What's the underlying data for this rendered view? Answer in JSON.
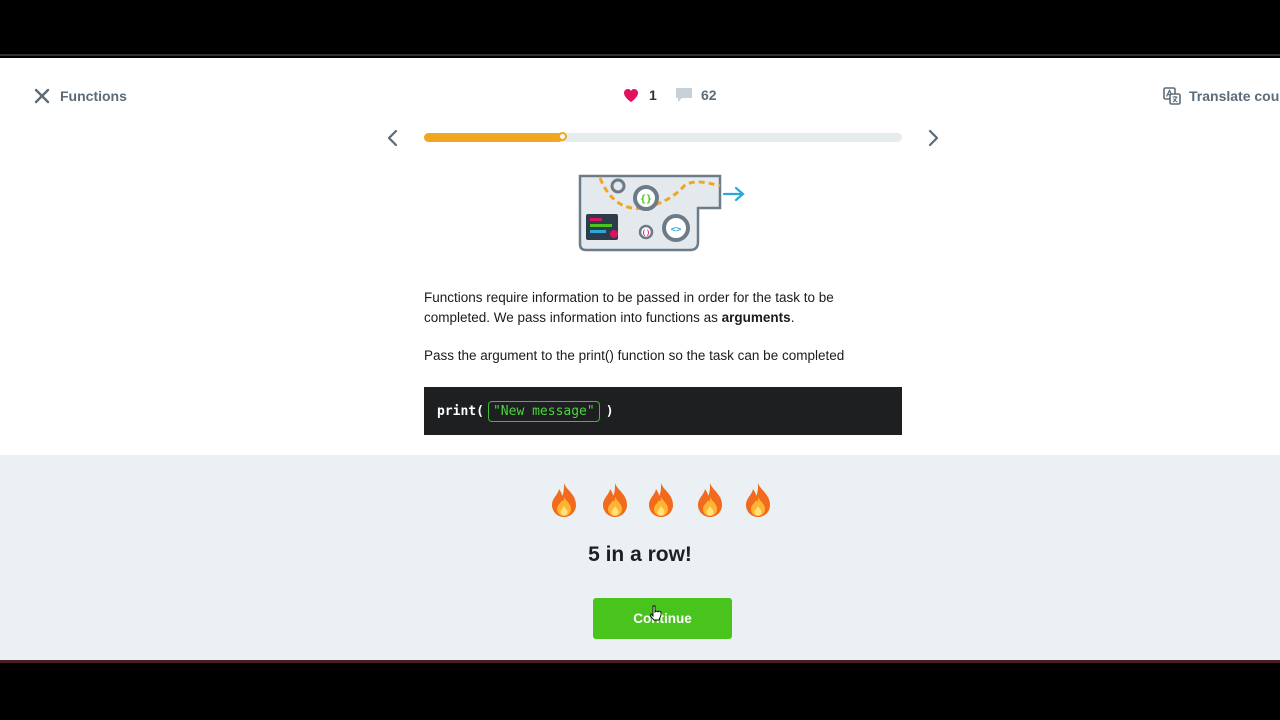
{
  "header": {
    "lesson_title": "Functions",
    "likes_count": "1",
    "comments_count": "62",
    "translate_label": "Translate course"
  },
  "progress": {
    "fraction": 0.29,
    "color": "#f0a71f"
  },
  "content": {
    "paragraph1_part1": "Functions require information to be passed in order for the task to be completed. We pass information into functions as ",
    "paragraph1_bold": "arguments",
    "paragraph1_end": ".",
    "paragraph2": "Pass the argument to the print() function so the task can be completed"
  },
  "code": {
    "function": "print(",
    "argument": "\"New message\"",
    "close_paren": ")"
  },
  "streak": {
    "flame_count": 5,
    "message": "5 in a row!",
    "continue_label": "Continue"
  },
  "colors": {
    "accent_green": "#48c41c",
    "heart": "#e0115f",
    "code_bg": "#1d1f20"
  },
  "icons": [
    "close-icon",
    "heart-icon",
    "comment-icon",
    "translate-icon",
    "chevron-left-icon",
    "chevron-right-icon",
    "flame-icon"
  ]
}
